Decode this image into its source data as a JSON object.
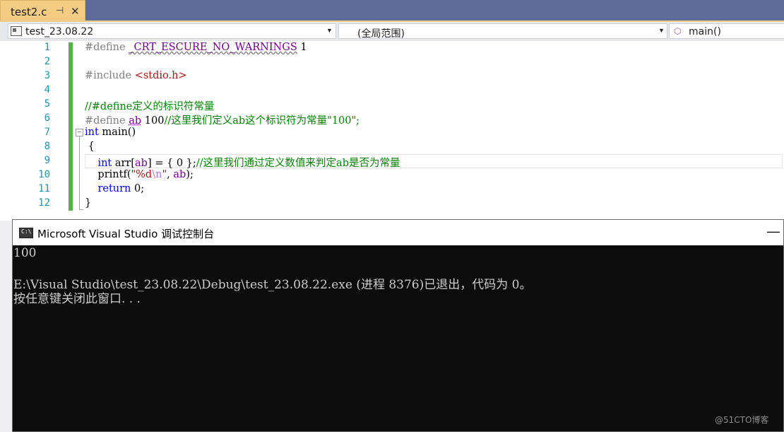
{
  "tab": {
    "filename": "test2.c",
    "pin_glyph": "⊣",
    "close_glyph": "✕"
  },
  "navbar": {
    "project": "test_23.08.22",
    "scope": "(全局范围)",
    "function": "main()"
  },
  "editor": {
    "line_numbers": [
      "1",
      "2",
      "3",
      "4",
      "5",
      "6",
      "7",
      "8",
      "9",
      "10",
      "11",
      "12"
    ]
  },
  "console": {
    "title": "Microsoft Visual Studio 调试控制台",
    "icon_text": "C:\\",
    "output": [
      "100",
      "",
      "E:\\Visual Studio\\test_23.08.22\\Debug\\test_23.08.22.exe (进程 8376)已退出，代码为 0。",
      "按任意键关闭此窗口. . ."
    ]
  },
  "watermark": "@51CTO博客",
  "colors": {
    "accent_tab": "#f5cc84",
    "tabstrip": "#5d6b99",
    "change_bar": "#57b14c",
    "console_bg": "#0c0c0c"
  }
}
